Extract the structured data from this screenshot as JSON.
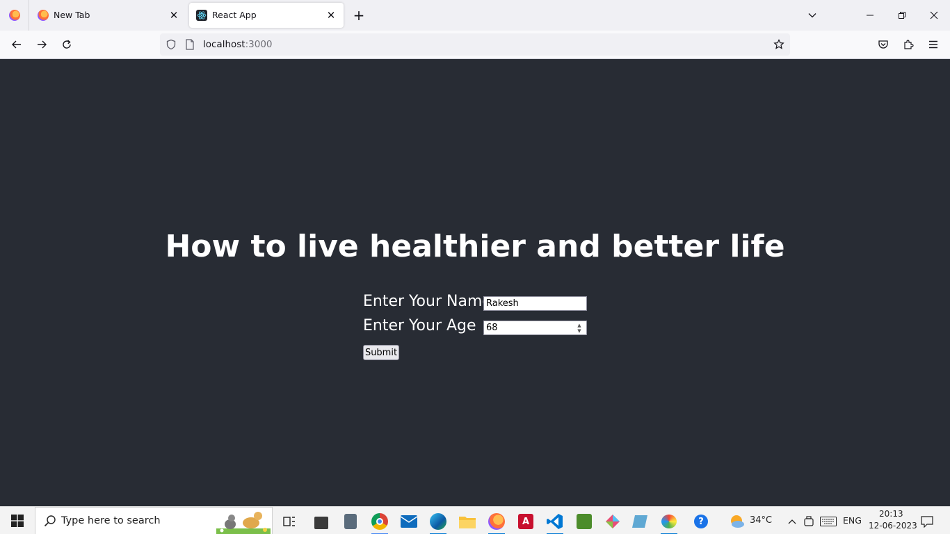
{
  "browser": {
    "tabs": [
      {
        "title": "New Tab",
        "active": false,
        "icon": "firefox-icon"
      },
      {
        "title": "React App",
        "active": true,
        "icon": "react-icon"
      }
    ],
    "url_host": "localhost",
    "url_port": ":3000"
  },
  "page": {
    "heading": "How to live healthier and better life",
    "name_label": "Enter Your Name",
    "name_value": "Rakesh",
    "age_label": "Enter Your Age",
    "age_value": "68",
    "submit_label": "Submit",
    "background": "#282c34"
  },
  "taskbar": {
    "search_placeholder": "Type here to search",
    "weather_temp": "34°C",
    "language": "ENG",
    "time": "20:13",
    "date": "12-06-2023"
  }
}
